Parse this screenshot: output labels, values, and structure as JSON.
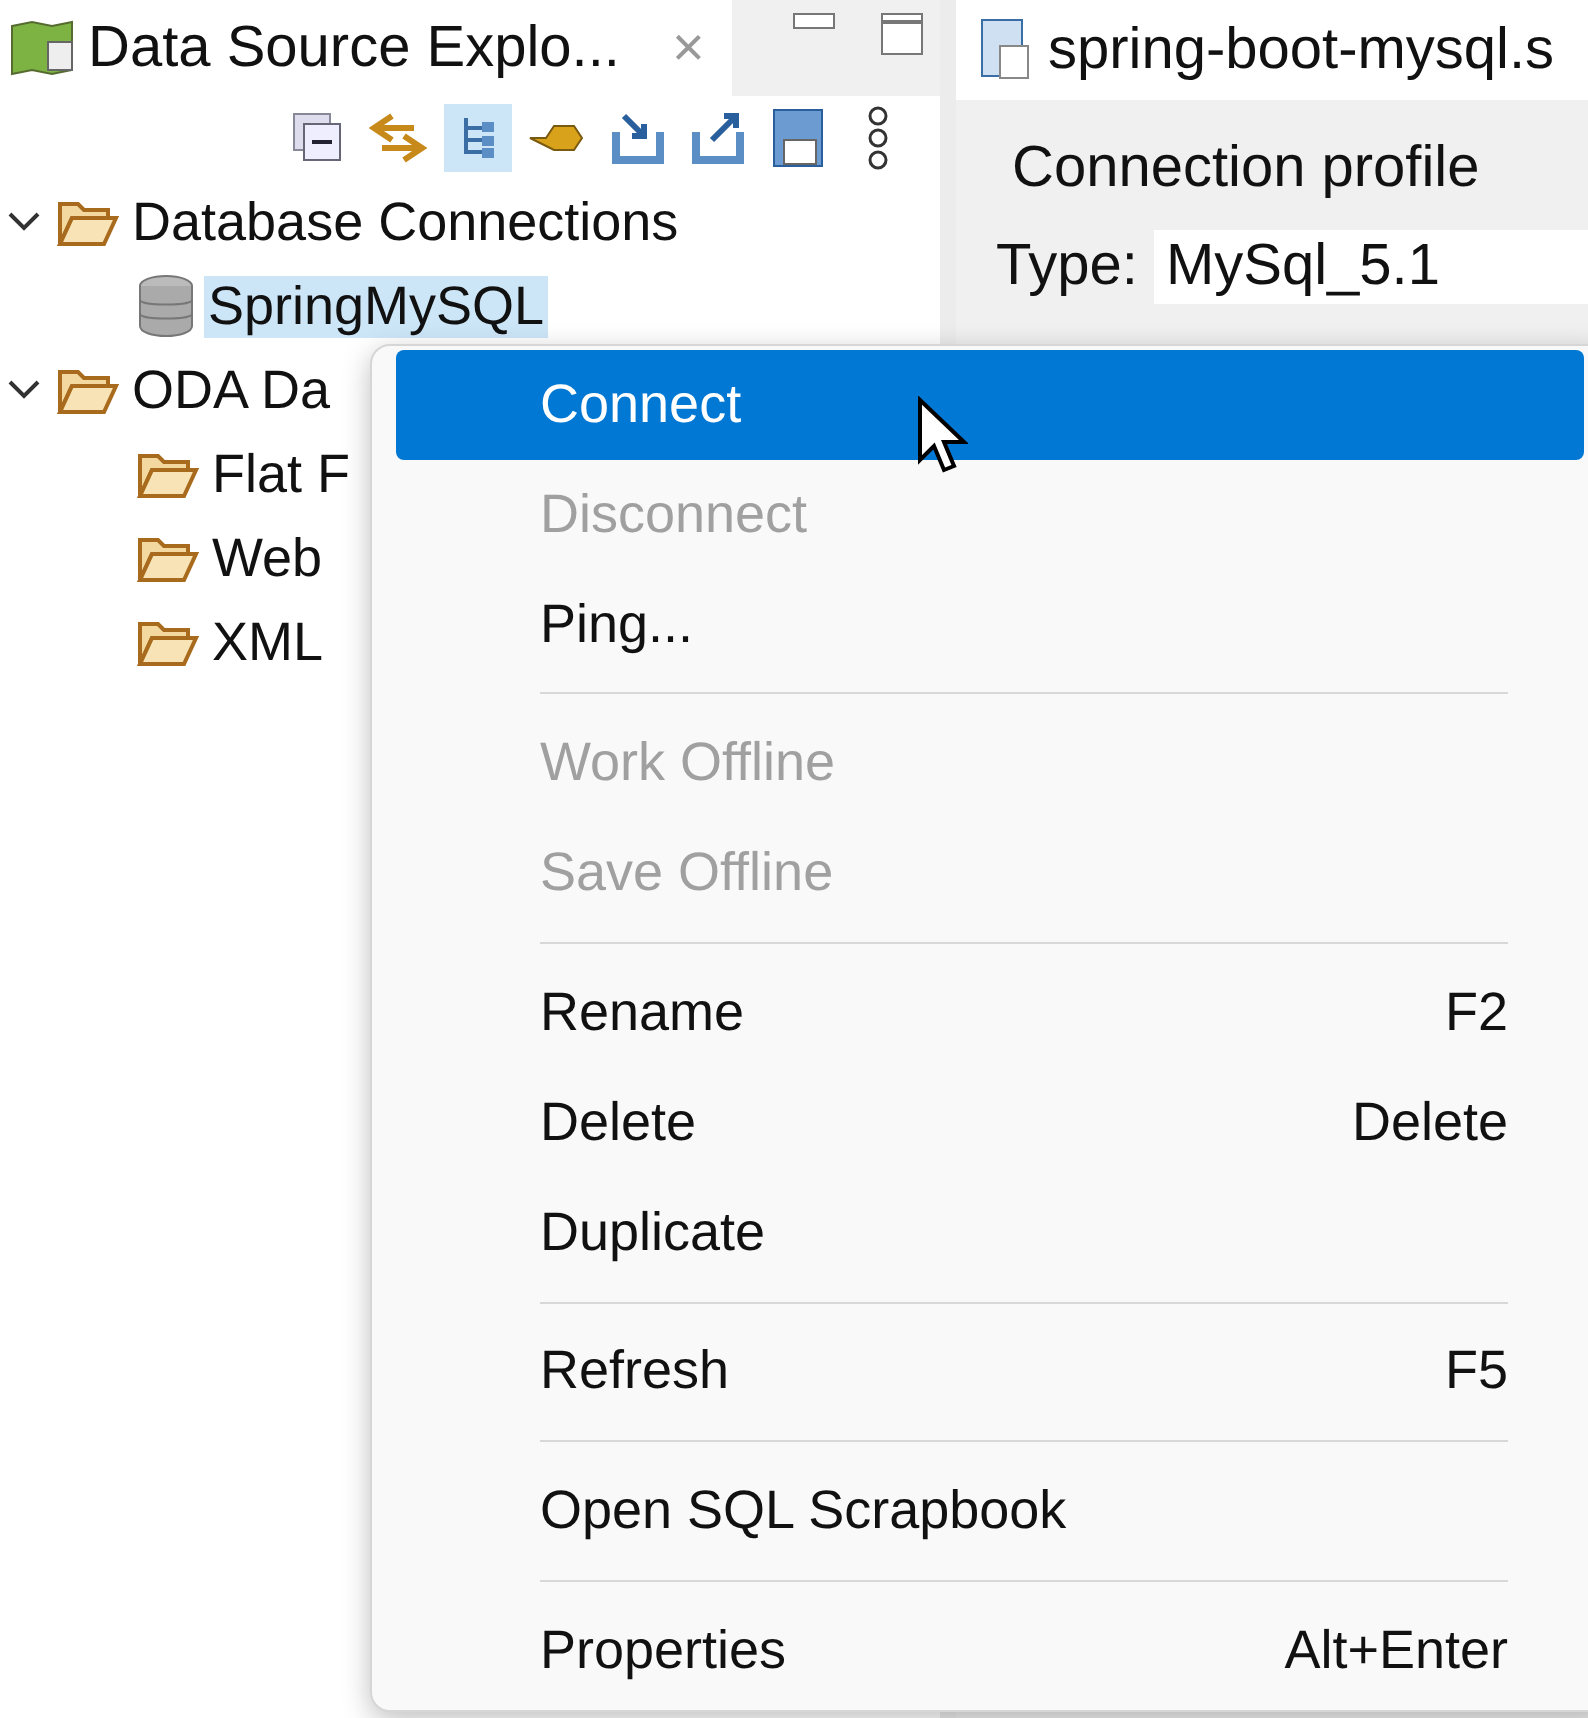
{
  "view_tab": {
    "title": "Data Source Explo...",
    "close": "×"
  },
  "tree": [
    {
      "label": "Database Connections",
      "kind": "folder",
      "expanded": true,
      "selected": false,
      "children": [
        {
          "label": "SpringMySQL",
          "kind": "database",
          "selected": true
        }
      ]
    },
    {
      "label": "ODA Da",
      "kind": "folder",
      "expanded": true,
      "selected": false,
      "children": [
        {
          "label": "Flat F",
          "kind": "folder",
          "selected": false
        },
        {
          "label": "Web",
          "kind": "folder",
          "selected": false
        },
        {
          "label": "XML",
          "kind": "folder",
          "selected": false
        }
      ]
    }
  ],
  "editor_tab": {
    "title": "spring-boot-mysql.s"
  },
  "editor": {
    "section": "Connection profile",
    "type_label": "Type:",
    "type_value": "MySql_5.1"
  },
  "context_menu": [
    {
      "kind": "item",
      "label": "Connect",
      "selected": true,
      "disabled": false
    },
    {
      "kind": "item",
      "label": "Disconnect",
      "selected": false,
      "disabled": true
    },
    {
      "kind": "item",
      "label": "Ping...",
      "selected": false,
      "disabled": false
    },
    {
      "kind": "separator"
    },
    {
      "kind": "item",
      "label": "Work Offline",
      "selected": false,
      "disabled": true
    },
    {
      "kind": "item",
      "label": "Save Offline",
      "selected": false,
      "disabled": true
    },
    {
      "kind": "separator"
    },
    {
      "kind": "item",
      "label": "Rename",
      "shortcut": "F2",
      "selected": false,
      "disabled": false
    },
    {
      "kind": "item",
      "label": "Delete",
      "shortcut": "Delete",
      "selected": false,
      "disabled": false
    },
    {
      "kind": "item",
      "label": "Duplicate",
      "selected": false,
      "disabled": false
    },
    {
      "kind": "separator"
    },
    {
      "kind": "item",
      "label": "Refresh",
      "shortcut": "F5",
      "selected": false,
      "disabled": false
    },
    {
      "kind": "separator"
    },
    {
      "kind": "item",
      "label": "Open SQL Scrapbook",
      "selected": false,
      "disabled": false
    },
    {
      "kind": "separator"
    },
    {
      "kind": "item",
      "label": "Properties",
      "shortcut": "Alt+Enter",
      "selected": false,
      "disabled": false
    }
  ]
}
